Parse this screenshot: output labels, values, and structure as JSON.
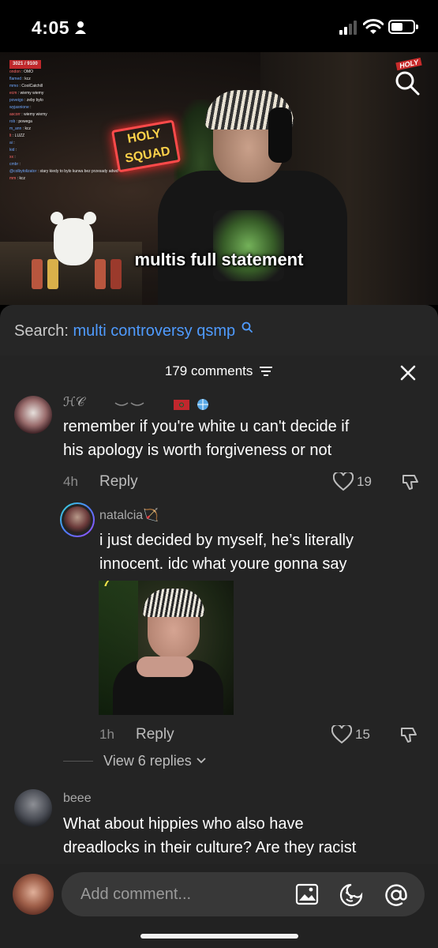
{
  "status_bar": {
    "time": "4:05"
  },
  "video": {
    "caption": "multis full statement",
    "neon_sign": "HOLY SQUAD",
    "logo": "HOLY",
    "chat": {
      "header": "3021 / 9100",
      "rows": [
        {
          "name": "ondon",
          "msg": "OMO"
        },
        {
          "name": "flamed",
          "msg": "kcz"
        },
        {
          "name": "mmo",
          "msg": "CoolCatchill"
        },
        {
          "name": "ecm",
          "msg": "wiemy wiemy"
        },
        {
          "name": "poveigo",
          "msg": "zeby bylo"
        },
        {
          "name": "wyjasnione",
          "msg": ""
        },
        {
          "name": "ascorr",
          "msg": "wiemy wiemy"
        },
        {
          "name": "rob",
          "msg": "powega"
        },
        {
          "name": "m_ann",
          "msg": "kcz"
        },
        {
          "name": "lt",
          "msg": "LUZZ"
        },
        {
          "name": "ai",
          "msg": ""
        },
        {
          "name": "kid",
          "msg": ""
        },
        {
          "name": "xx",
          "msg": ""
        },
        {
          "name": "cmbr",
          "msg": ""
        },
        {
          "name": "@colbytolizator",
          "msg": "stary kiedy to bylo kurwa bez przesady adwd"
        },
        {
          "name": "mm",
          "msg": "kcz"
        }
      ]
    }
  },
  "search": {
    "label": "Search:",
    "query": "multi controversy qsmp"
  },
  "comments_header": {
    "count_label": "179 comments"
  },
  "comments": [
    {
      "username": "ℋ𝒞",
      "text_line1": "remember if you're white u can't decide if",
      "text_line2": "his apology is worth forgiveness or not",
      "time": "4h",
      "reply_label": "Reply",
      "likes": "19"
    },
    {
      "username": "natalcia🏹",
      "text_line1": "i just decided by myself, he’s literally",
      "text_line2": "innocent. idc what youre gonna say",
      "time": "1h",
      "reply_label": "Reply",
      "likes": "15"
    },
    {
      "username": "beee",
      "text_line1": "What about hippies who also have",
      "text_line2": "dreadlocks in their culture? Are they racist"
    }
  ],
  "view_replies_label": "View 6 replies",
  "add_comment": {
    "placeholder": "Add comment..."
  },
  "colors": {
    "link_blue": "#4f9bff",
    "panel_bg": "#242424",
    "input_bg": "#383838",
    "live_red": "#c0282b"
  }
}
